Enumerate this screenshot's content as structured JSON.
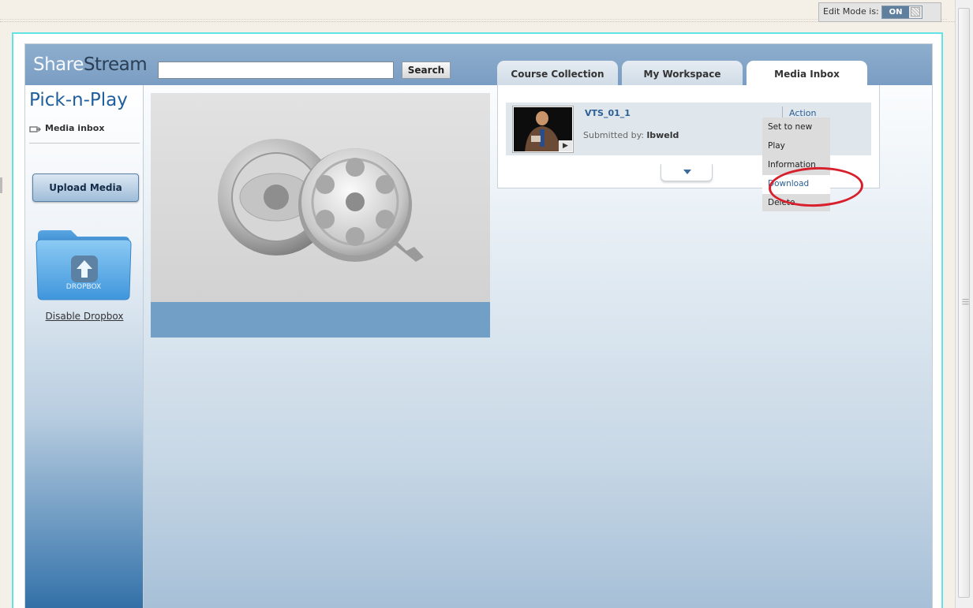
{
  "edit_mode": {
    "label": "Edit Mode is:",
    "state": "ON"
  },
  "header": {
    "logo_share": "Share",
    "logo_stream": "Stream",
    "search_placeholder": "",
    "search_button": "Search",
    "tabs": [
      {
        "label": "Course Collection",
        "active": false
      },
      {
        "label": "My Workspace",
        "active": false
      },
      {
        "label": "Media Inbox",
        "active": true
      }
    ]
  },
  "sidebar": {
    "title": "Pick-n-Play",
    "inbox_label": "Media inbox",
    "upload_button": "Upload Media",
    "dropbox_label": "DROPBOX",
    "disable_dropbox": "Disable Dropbox"
  },
  "media": {
    "title": "VTS_01_1",
    "submitted_label": "Submitted by:",
    "submitted_by": "lbweld",
    "action_label": "Action"
  },
  "action_menu": {
    "items": [
      "Set to new",
      "Play",
      "Information",
      "Download",
      "Delete"
    ],
    "highlighted": "Download"
  },
  "colors": {
    "accent": "#2b5f95",
    "header": "#7a9dc3",
    "highlight_ring": "#d8202c",
    "frame_border": "#62e4e4"
  }
}
